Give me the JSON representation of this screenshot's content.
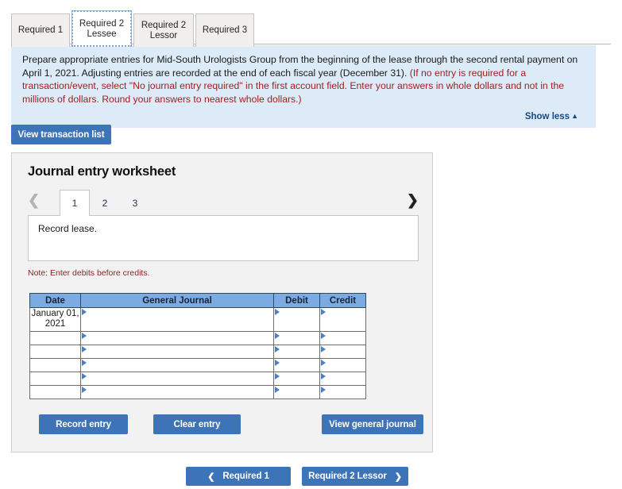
{
  "tabs": [
    {
      "label": "Required 1",
      "active": false
    },
    {
      "label": "Required 2 Lessee",
      "active": true
    },
    {
      "label": "Required 2 Lessor",
      "active": false
    },
    {
      "label": "Required 3",
      "active": false
    }
  ],
  "instructions": {
    "black_text": "Prepare appropriate entries for Mid-South Urologists Group from the beginning of the lease through the second rental payment on April 1, 2021. Adjusting entries are recorded at the end of each fiscal year (December 31).",
    "red_text": "(If no entry is required for a transaction/event, select \"No journal entry required\" in the first account field. Enter your answers in whole dollars and not in the millions of dollars. Round your answers to nearest whole dollars.)",
    "show_less_label": "Show less",
    "show_less_caret": "▲",
    "background_color": "#dcebf7",
    "red_color": "#a02020",
    "link_color": "#17477e"
  },
  "toolbar": {
    "view_transaction_list_label": "View transaction list"
  },
  "worksheet": {
    "title": "Journal entry worksheet",
    "pager": {
      "prev_icon": "❮",
      "next_icon": "❯",
      "pages": [
        {
          "label": "1",
          "active": true
        },
        {
          "label": "2",
          "active": false
        },
        {
          "label": "3",
          "active": false
        }
      ]
    },
    "description": "Record lease.",
    "note": "Note: Enter debits before credits.",
    "table": {
      "headers": [
        "Date",
        "General Journal",
        "Debit",
        "Credit"
      ],
      "rows": [
        {
          "date": "January 01, 2021",
          "general_journal": "",
          "debit": "",
          "credit": ""
        },
        {
          "date": "",
          "general_journal": "",
          "debit": "",
          "credit": ""
        },
        {
          "date": "",
          "general_journal": "",
          "debit": "",
          "credit": ""
        },
        {
          "date": "",
          "general_journal": "",
          "debit": "",
          "credit": ""
        },
        {
          "date": "",
          "general_journal": "",
          "debit": "",
          "credit": ""
        },
        {
          "date": "",
          "general_journal": "",
          "debit": "",
          "credit": ""
        }
      ],
      "header_color": "#7babe0",
      "marker_color": "#4a7fc1"
    },
    "actions": {
      "record_entry_label": "Record entry",
      "clear_entry_label": "Clear entry",
      "view_general_journal_label": "View general journal"
    }
  },
  "bottom_nav": {
    "prev_label": "Required 1",
    "prev_icon": "❮",
    "next_label": "Required 2 Lessor",
    "next_icon": "❯"
  },
  "theme": {
    "button_blue": "#3d74b8",
    "panel_gray": "#f2f2f2"
  }
}
